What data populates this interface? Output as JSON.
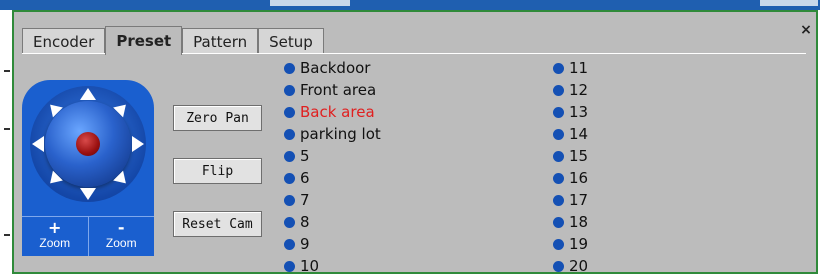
{
  "window": {
    "close_glyph": "×"
  },
  "tabs": [
    {
      "label": "Encoder",
      "active": false
    },
    {
      "label": "Preset",
      "active": true
    },
    {
      "label": "Pattern",
      "active": false
    },
    {
      "label": "Setup",
      "active": false
    }
  ],
  "controls": {
    "joystick": {
      "zoom_in_symbol": "+",
      "zoom_in_label": "Zoom",
      "zoom_out_symbol": "-",
      "zoom_out_label": "Zoom"
    },
    "buttons": [
      "Zero Pan",
      "Flip",
      "Reset Cam"
    ]
  },
  "presets": {
    "active_index": 2,
    "active_color": "#e02020",
    "dot_color": "#1450b4",
    "column1": [
      "Backdoor",
      "Front area",
      "Back area",
      "parking lot",
      "5",
      "6",
      "7",
      "8",
      "9",
      "10"
    ],
    "column2": [
      "11",
      "12",
      "13",
      "14",
      "15",
      "16",
      "17",
      "18",
      "19",
      "20"
    ]
  },
  "colors": {
    "frame_border": "#2f8a3a",
    "panel_bg": "#bcbcbc",
    "joystick_blue": "#1a5fcf"
  }
}
